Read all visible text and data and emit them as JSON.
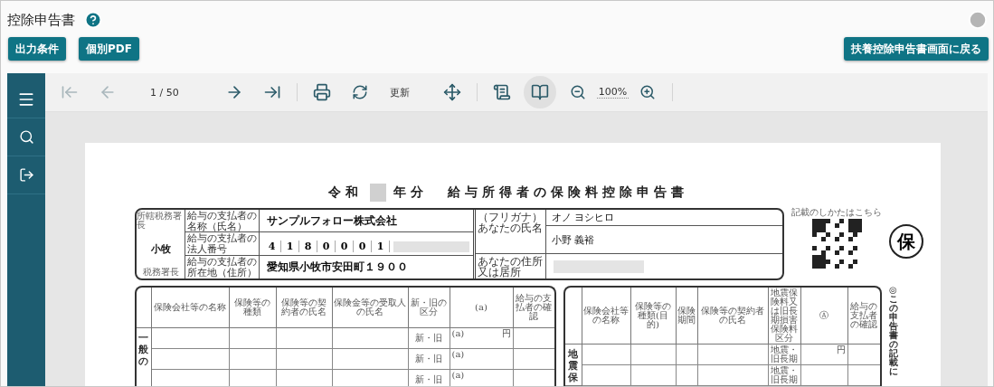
{
  "header": {
    "title": "控除申告書"
  },
  "buttons": [
    {
      "label": "出力条件"
    },
    {
      "label": "個別PDF"
    }
  ],
  "back_button": {
    "label": "扶養控除申告書画面に戻る"
  },
  "toolbar": {
    "first_page": {
      "disabled": true
    },
    "previous_page": {
      "disabled": true
    },
    "page": "1 / 50",
    "next_page": {
      "disabled": false
    },
    "last_page": {
      "disabled": false
    },
    "refresh_label": "更新",
    "book_view": {
      "selected": true
    },
    "zoom": "100%"
  },
  "document": {
    "title": {
      "era": "令和",
      "year_suffix": "年分",
      "name": "給与所得者の保険料控除申告書"
    },
    "payer": {
      "office_label": "所轄税務署長",
      "office": "小牧",
      "office_suffix": "税務署長",
      "rows": [
        {
          "kind": "text",
          "label": "給与の支払者の名称（氏名）",
          "value": "サンプルフォロー株式会社"
        },
        {
          "kind": "digits",
          "label": "給与の支払者の法人番号",
          "digits": [
            "4",
            "1",
            "8",
            "0",
            "0",
            "0",
            "1"
          ]
        },
        {
          "kind": "text",
          "label": "給与の支払者の所在地（住所）",
          "value": "愛知県小牧市安田町１９００"
        }
      ]
    },
    "employee": {
      "name_label": "（フリガナ）あなたの氏名",
      "furigana": "オノ ヨシヒロ",
      "name": "小野 義裕",
      "address_label": "あなたの住所又は居所"
    },
    "qr_caption": "記載のしかたはこちら",
    "stamp": "保",
    "general_table": {
      "section": "一般の",
      "columns": [
        "保険会社等の名称",
        "保険等の種類",
        "保険等の契約者の氏名",
        "保険金等の受取人の氏名",
        "新・旧の区分",
        "(a)",
        "給与の支払者の確認"
      ],
      "rows": [
        {
          "kind_label": "新・旧",
          "amount_label": "(a)",
          "unit": "円"
        },
        {
          "kind_label": "新・旧",
          "amount_label": "(a)"
        },
        {
          "kind_label": "新・旧",
          "amount_label": "(a)"
        }
      ]
    },
    "earthquake_table": {
      "section": "地震保",
      "columns": [
        "保険会社等の名称",
        "保険等の種類(目的)",
        "保険期間",
        "保険等の契約者の氏名",
        "地震保険料又は旧長期損害保険料区分",
        "Ⓐ",
        "給与の支払者の確認"
      ],
      "rows": [
        {
          "kind_label": "地震・旧長期",
          "unit": "円"
        },
        {
          "kind_label": "地震・旧長期"
        }
      ]
    },
    "side_note": "◎この申告書の記載に"
  }
}
